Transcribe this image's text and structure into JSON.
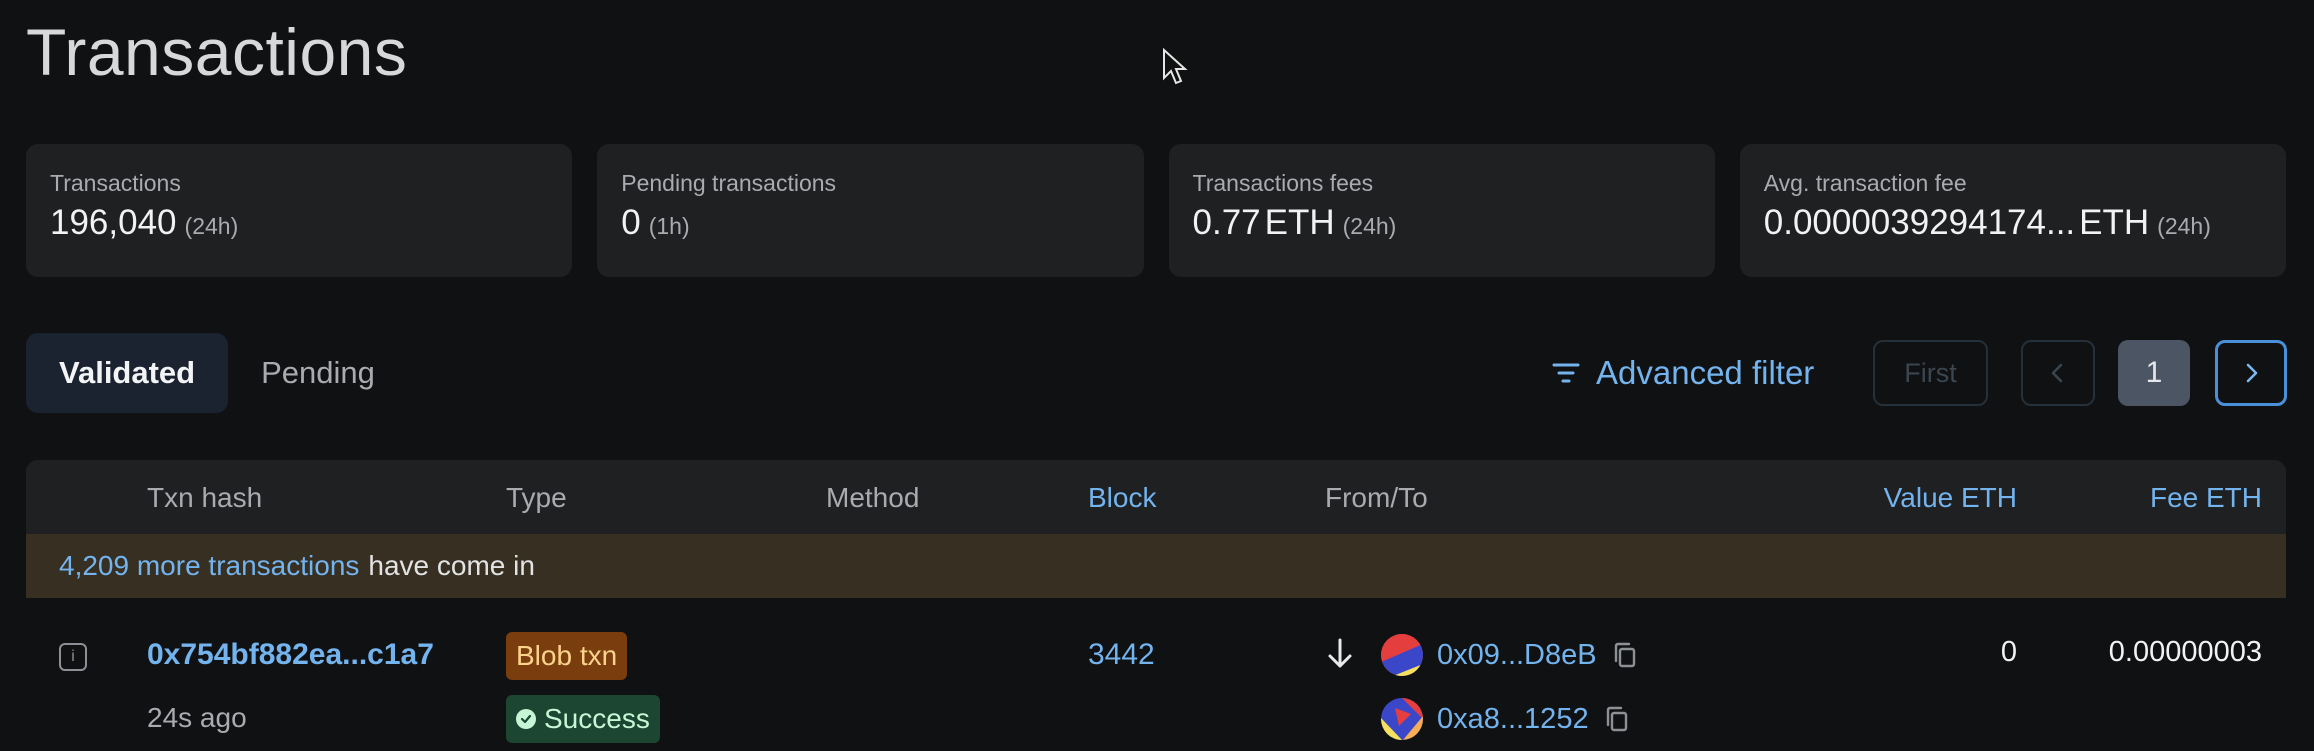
{
  "page": {
    "title": "Transactions"
  },
  "stats": [
    {
      "label": "Transactions",
      "value": "196,040",
      "unit": "",
      "period": "(24h)"
    },
    {
      "label": "Pending transactions",
      "value": "0",
      "unit": "",
      "period": "(1h)"
    },
    {
      "label": "Transactions fees",
      "value": "0.77",
      "unit": "ETH",
      "period": "(24h)"
    },
    {
      "label": "Avg. transaction fee",
      "value": "0.0000039294174...",
      "unit": "ETH",
      "period": "(24h)"
    }
  ],
  "tabs": [
    {
      "label": "Validated",
      "active": true
    },
    {
      "label": "Pending",
      "active": false
    }
  ],
  "filter": {
    "label": "Advanced filter"
  },
  "pagination": {
    "first_label": "First",
    "current_page": "1"
  },
  "table": {
    "headers": {
      "hash": "Txn hash",
      "type": "Type",
      "method": "Method",
      "block": "Block",
      "from_to": "From/To",
      "value": "Value ETH",
      "fee": "Fee ETH"
    },
    "banner": {
      "count_link": "4,209 more transactions",
      "rest": "have come in"
    },
    "rows": [
      {
        "hash": "0x754bf882ea...c1a7",
        "age": "24s ago",
        "type": "Blob txn",
        "status": "Success",
        "method": "",
        "block": "3442",
        "from": "0x09...D8eB",
        "to": "0xa8...1252",
        "value": "0",
        "fee": "0.00000003"
      }
    ]
  },
  "icons": {
    "filter": "filter-icon",
    "prev": "chevron-left-icon",
    "next": "chevron-right-icon",
    "info": "info-icon",
    "direction": "arrow-down-icon",
    "copy": "copy-icon",
    "status": "check-circle-icon"
  },
  "colors": {
    "background": "#101112",
    "link": "#73b3ee",
    "blob_badge_bg": "#7a3d0d",
    "success_badge_bg": "#1c4532",
    "banner_bg": "#372f22"
  }
}
